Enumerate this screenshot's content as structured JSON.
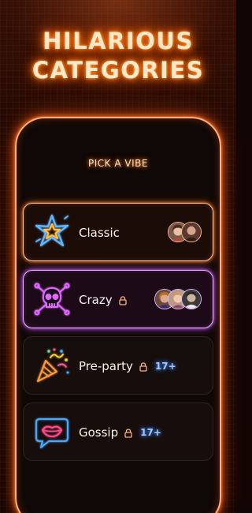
{
  "header": {
    "title_line1": "HILARIOUS",
    "title_line2": "CATEGORIES"
  },
  "subtitle": "PICK A VIBE",
  "categories": [
    {
      "label": "Classic",
      "icon": "star-icon",
      "locked": false,
      "age_badge": "",
      "avatars": [
        "avatar-1",
        "avatar-2"
      ],
      "accent": "#ffb07a"
    },
    {
      "label": "Crazy",
      "icon": "skull-crossbones-icon",
      "locked": true,
      "age_badge": "",
      "avatars": [
        "avatar-1",
        "avatar-2",
        "avatar-3"
      ],
      "accent": "#d25cff"
    },
    {
      "label": "Pre-party",
      "icon": "party-popper-icon",
      "locked": true,
      "age_badge": "17+",
      "avatars": [],
      "accent": "#ff9a3d"
    },
    {
      "label": "Gossip",
      "icon": "lips-speech-bubble-icon",
      "locked": true,
      "age_badge": "17+",
      "avatars": [],
      "accent": "#4aa8ff"
    }
  ],
  "colors": {
    "neon_orange": "#ff7a1a",
    "neon_purple": "#d25cff",
    "neon_blue": "#3f8dff",
    "background": "#120604"
  }
}
